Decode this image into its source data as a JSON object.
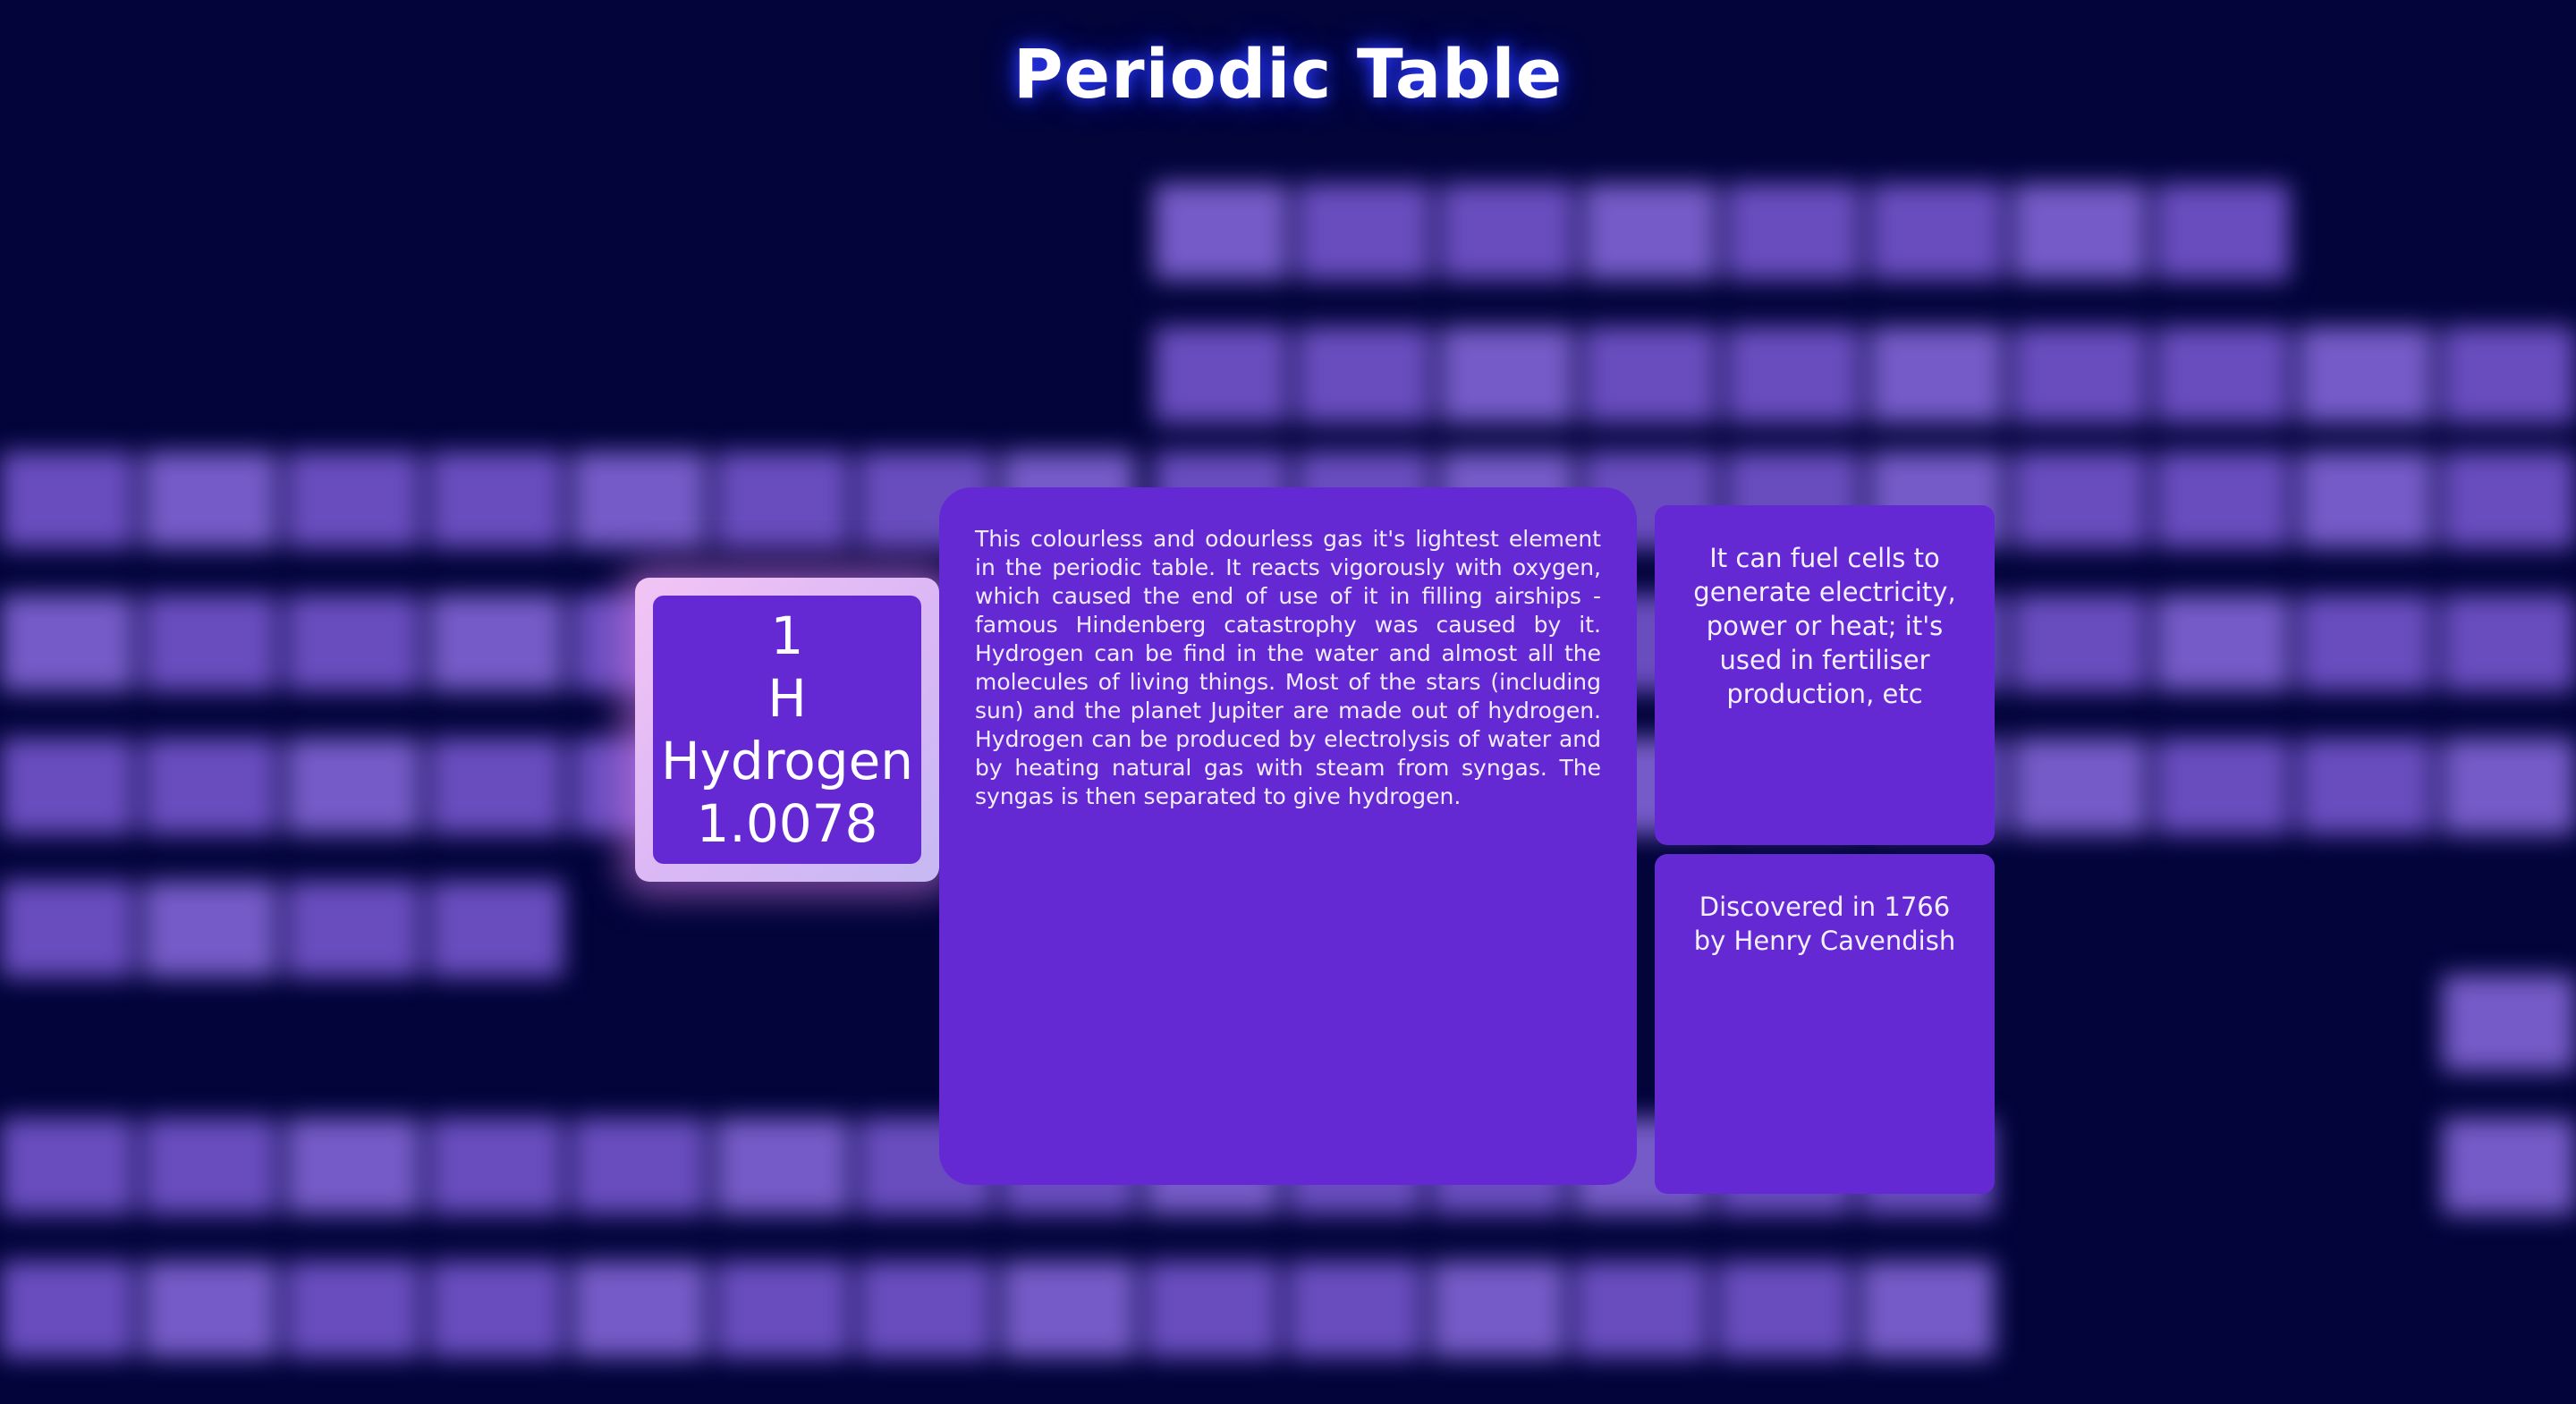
{
  "page": {
    "title": "Periodic Table"
  },
  "element": {
    "number": "1",
    "symbol": "H",
    "name": "Hydrogen",
    "mass": "1.0078"
  },
  "description": "This colourless and odourless gas it's lightest element in the periodic table. It reacts vigorously with oxygen, which caused the end of use of it in filling airships - famous Hindenberg catastrophy was caused by it. Hydrogen can be find in the water and almost all the molecules of living things. Most of the stars (including sun) and the planet Jupiter are made out of hydrogen. Hydrogen can be produced by electrolysis of water and by heating natural gas with steam from syngas. The syngas is then separated to give hydrogen.",
  "cards": {
    "uses": "It can fuel cells to generate electricity, power or heat; it's used in fertiliser production, etc",
    "discovery": "Discovered in 1766 by Henry Cavendish"
  },
  "colors": {
    "background": "#02043a",
    "panel": "#6429d3",
    "blurred_cell": "#7b5ad6",
    "title_glow": "#2d3cff",
    "tile_glow": "#d278e6"
  }
}
